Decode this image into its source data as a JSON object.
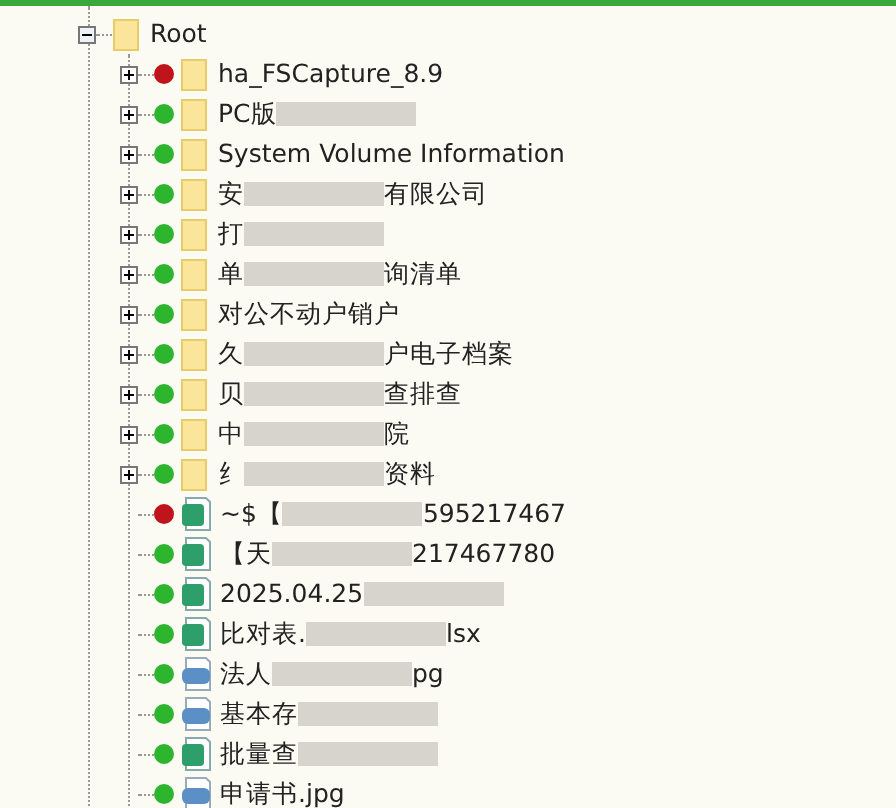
{
  "root": {
    "label": "Root",
    "expanded": true,
    "children": [
      {
        "kind": "folder",
        "color": "#c0141c",
        "expanded": false,
        "text": "ha_FSCapture_8.9"
      },
      {
        "kind": "folder",
        "color": "#2db52d",
        "expanded": false,
        "text": "PC版",
        "redacted": true
      },
      {
        "kind": "folder",
        "color": "#2db52d",
        "expanded": false,
        "text": "System Volume Information"
      },
      {
        "kind": "folder",
        "color": "#2db52d",
        "expanded": false,
        "text": "安",
        "redacted": true,
        "tail": "有限公司"
      },
      {
        "kind": "folder",
        "color": "#2db52d",
        "expanded": false,
        "text": "打",
        "redacted": true
      },
      {
        "kind": "folder",
        "color": "#2db52d",
        "expanded": false,
        "text": "单",
        "redacted": true,
        "tail": "询清单"
      },
      {
        "kind": "folder",
        "color": "#2db52d",
        "expanded": false,
        "text": "对公不动户销户"
      },
      {
        "kind": "folder",
        "color": "#2db52d",
        "expanded": false,
        "text": "久",
        "redacted": true,
        "tail": "户电子档案"
      },
      {
        "kind": "folder",
        "color": "#2db52d",
        "expanded": false,
        "text": "贝",
        "redacted": true,
        "tail": "查排查"
      },
      {
        "kind": "folder",
        "color": "#2db52d",
        "expanded": false,
        "text": "中",
        "redacted": true,
        "tail": "院"
      },
      {
        "kind": "folder",
        "color": "#2db52d",
        "expanded": false,
        "text": "纟",
        "redacted": true,
        "tail": "资料"
      },
      {
        "kind": "sheet",
        "color": "#c0141c",
        "text": "~$【",
        "redacted": true,
        "tail": "595217467"
      },
      {
        "kind": "sheet",
        "color": "#2db52d",
        "text": "【天",
        "redacted": true,
        "tail": "217467780"
      },
      {
        "kind": "sheet",
        "color": "#2db52d",
        "text": "2025.04.25",
        "redacted": true
      },
      {
        "kind": "sheet",
        "color": "#2db52d",
        "text": "比对表.",
        "redacted": true,
        "tail": "lsx"
      },
      {
        "kind": "image",
        "color": "#2db52d",
        "text": "法人",
        "redacted": true,
        "tail": "pg"
      },
      {
        "kind": "image",
        "color": "#2db52d",
        "text": "基本存",
        "redacted": true
      },
      {
        "kind": "sheet",
        "color": "#2db52d",
        "text": "批量查",
        "redacted": true
      },
      {
        "kind": "image",
        "color": "#2db52d",
        "text": "申请书.jpg"
      }
    ]
  }
}
